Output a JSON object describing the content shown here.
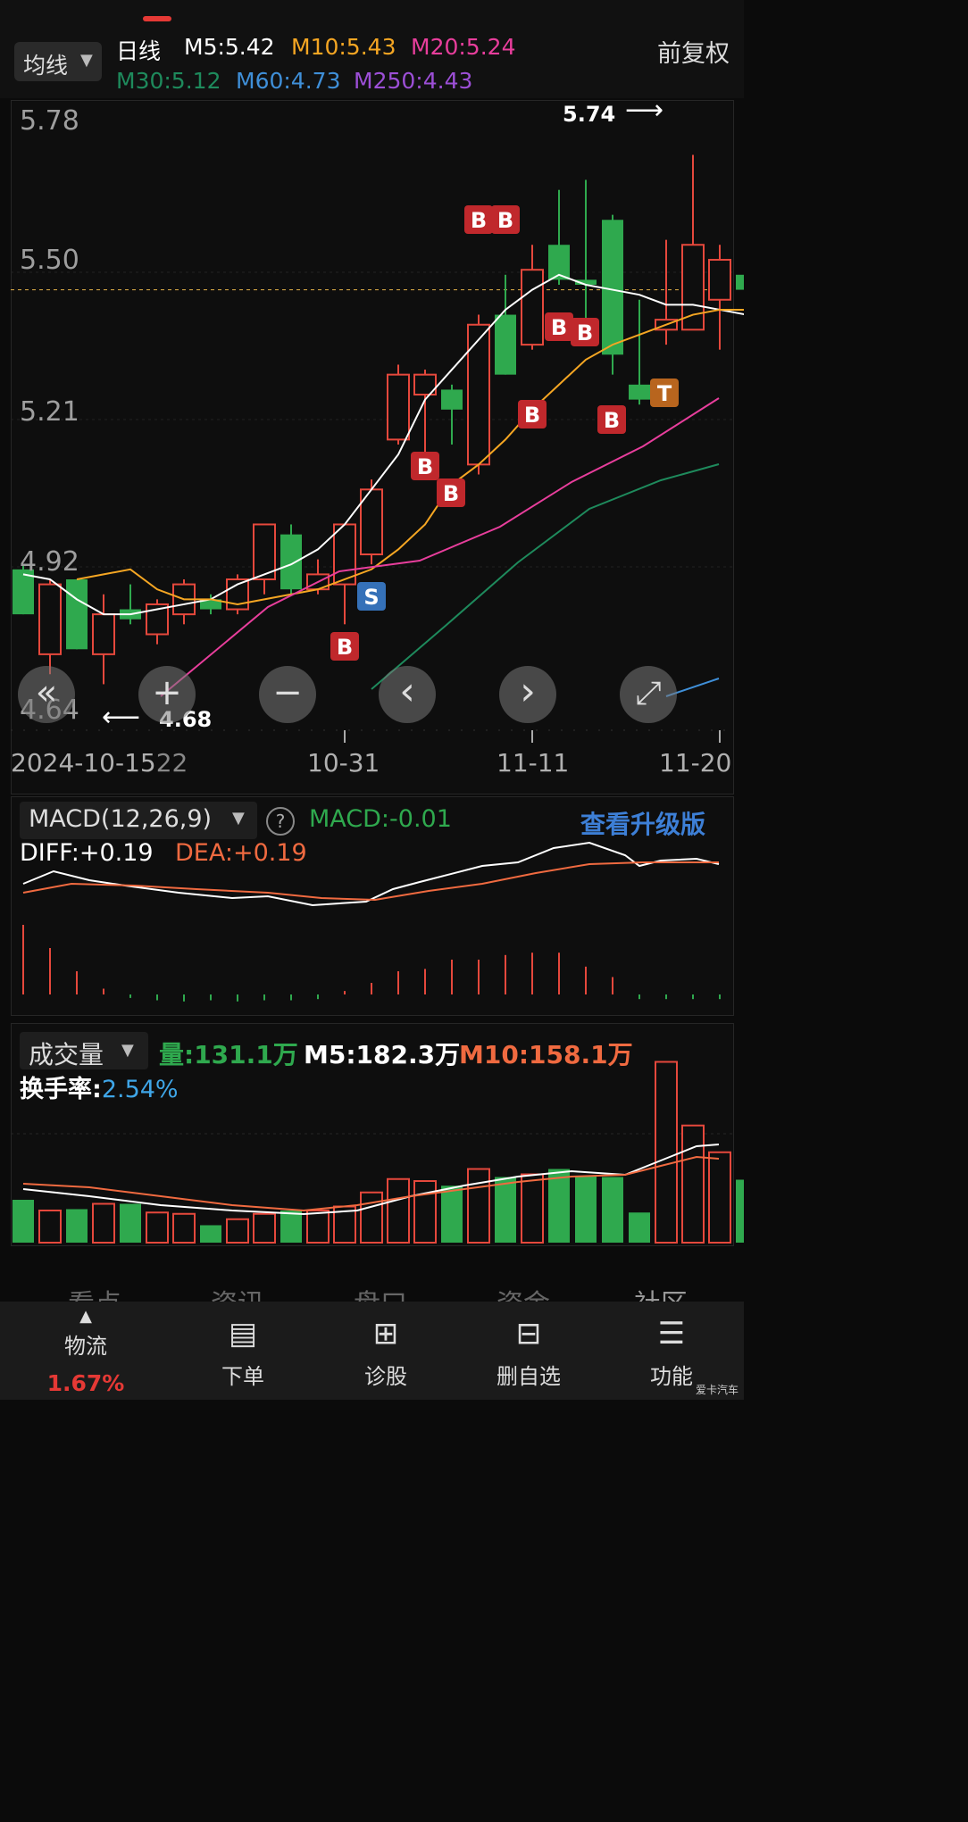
{
  "header": {
    "selector_label": "均线",
    "period_label": "日线",
    "adjust_label": "前复权",
    "ma_labels": [
      {
        "text": "M5:5.42",
        "color": "#ffffff"
      },
      {
        "text": "M10:5.43",
        "color": "#f5a623"
      },
      {
        "text": "M20:5.24",
        "color": "#e83e9c"
      },
      {
        "text": "M30:5.12",
        "color": "#1e8a5c"
      },
      {
        "text": "M60:4.73",
        "color": "#3f8fd8"
      },
      {
        "text": "M250:4.43",
        "color": "#9c4fd6"
      }
    ]
  },
  "main_chart": {
    "y_ticks": [
      "5.78",
      "5.50",
      "5.21",
      "4.92",
      "4.64"
    ],
    "x_ticks": [
      "2024-10-15",
      "22",
      "10-31",
      "11-11",
      "11-20"
    ],
    "high_marker": "5.74",
    "low_marker": "4.68",
    "controls": [
      "«",
      "+",
      "−",
      "‹",
      "›",
      "⤢"
    ]
  },
  "chart_data": [
    {
      "type": "candlestick",
      "y_range": [
        4.62,
        5.8
      ],
      "x": [
        "2024-10-14",
        "2024-10-15",
        "2024-10-16",
        "2024-10-17",
        "2024-10-18",
        "2024-10-21",
        "2024-10-22",
        "2024-10-23",
        "2024-10-24",
        "2024-10-25",
        "2024-10-28",
        "2024-10-29",
        "2024-10-30",
        "2024-10-31",
        "2024-11-01",
        "2024-11-04",
        "2024-11-05",
        "2024-11-06",
        "2024-11-07",
        "2024-11-08",
        "2024-11-11",
        "2024-11-12",
        "2024-11-13",
        "2024-11-14",
        "2024-11-15",
        "2024-11-18",
        "2024-11-19",
        "2024-11-20",
        "2024-11-21",
        "2024-11-22"
      ],
      "candles": [
        {
          "o": 4.91,
          "h": 4.92,
          "l": 4.82,
          "c": 4.82,
          "up": false
        },
        {
          "o": 4.74,
          "h": 4.89,
          "l": 4.7,
          "c": 4.88,
          "up": true
        },
        {
          "o": 4.89,
          "h": 4.89,
          "l": 4.75,
          "c": 4.75,
          "up": false
        },
        {
          "o": 4.74,
          "h": 4.86,
          "l": 4.68,
          "c": 4.82,
          "up": true
        },
        {
          "o": 4.83,
          "h": 4.88,
          "l": 4.8,
          "c": 4.81,
          "up": false
        },
        {
          "o": 4.78,
          "h": 4.85,
          "l": 4.76,
          "c": 4.84,
          "up": true
        },
        {
          "o": 4.82,
          "h": 4.89,
          "l": 4.8,
          "c": 4.88,
          "up": true
        },
        {
          "o": 4.85,
          "h": 4.86,
          "l": 4.82,
          "c": 4.83,
          "up": false
        },
        {
          "o": 4.83,
          "h": 4.9,
          "l": 4.82,
          "c": 4.89,
          "up": true
        },
        {
          "o": 4.89,
          "h": 4.96,
          "l": 4.86,
          "c": 5.0,
          "up": true
        },
        {
          "o": 4.98,
          "h": 5.0,
          "l": 4.86,
          "c": 4.87,
          "up": false
        },
        {
          "o": 4.87,
          "h": 4.93,
          "l": 4.86,
          "c": 4.9,
          "up": true
        },
        {
          "o": 4.88,
          "h": 5.0,
          "l": 4.8,
          "c": 5.0,
          "up": true
        },
        {
          "o": 4.94,
          "h": 5.09,
          "l": 4.92,
          "c": 5.07,
          "up": true
        },
        {
          "o": 5.17,
          "h": 5.32,
          "l": 5.16,
          "c": 5.3,
          "up": true
        },
        {
          "o": 5.26,
          "h": 5.31,
          "l": 5.1,
          "c": 5.3,
          "up": true
        },
        {
          "o": 5.23,
          "h": 5.28,
          "l": 5.16,
          "c": 5.27,
          "up": false
        },
        {
          "o": 5.12,
          "h": 5.42,
          "l": 5.1,
          "c": 5.4,
          "up": true
        },
        {
          "o": 5.42,
          "h": 5.5,
          "l": 5.3,
          "c": 5.3,
          "up": false
        },
        {
          "o": 5.36,
          "h": 5.56,
          "l": 5.35,
          "c": 5.51,
          "up": true
        },
        {
          "o": 5.56,
          "h": 5.67,
          "l": 5.48,
          "c": 5.49,
          "up": false
        },
        {
          "o": 5.49,
          "h": 5.69,
          "l": 5.4,
          "c": 5.48,
          "up": false
        },
        {
          "o": 5.61,
          "h": 5.62,
          "l": 5.3,
          "c": 5.34,
          "up": false
        },
        {
          "o": 5.25,
          "h": 5.45,
          "l": 5.24,
          "c": 5.28,
          "up": false
        },
        {
          "o": 5.41,
          "h": 5.57,
          "l": 5.36,
          "c": 5.39,
          "up": true
        },
        {
          "o": 5.39,
          "h": 5.74,
          "l": 5.39,
          "c": 5.56,
          "up": true
        },
        {
          "o": 5.53,
          "h": 5.56,
          "l": 5.35,
          "c": 5.45,
          "up": true
        },
        {
          "o": 5.5,
          "h": 5.52,
          "l": 5.42,
          "c": 5.47,
          "up": false
        }
      ],
      "ma5": [
        4.9,
        4.89,
        4.85,
        4.82,
        4.82,
        4.83,
        4.84,
        4.85,
        4.88,
        4.9,
        4.92,
        4.95,
        5.0,
        5.07,
        5.14,
        5.25,
        5.31,
        5.37,
        5.43,
        5.47,
        5.5,
        5.48,
        5.47,
        5.46,
        5.44,
        5.44,
        5.43,
        5.42
      ],
      "ma10": [
        4.89,
        4.9,
        4.91,
        4.87,
        4.85,
        4.85,
        4.84,
        4.85,
        4.86,
        4.87,
        4.89,
        4.91,
        4.95,
        5.0,
        5.08,
        5.12,
        5.17,
        5.23,
        5.28,
        5.33,
        5.36,
        5.38,
        5.4,
        5.42,
        5.43,
        5.43
      ]
    },
    {
      "type": "bar",
      "name": "MACD",
      "label": "MACD(12,26,9)",
      "macd_value": "MACD:-0.01",
      "diff_label": "DIFF:+0.19",
      "dea_label": "DEA:+0.19",
      "upgrade_label": "查看升级版",
      "values": [
        0.06,
        0.04,
        0.02,
        0.005,
        -0.003,
        -0.005,
        -0.006,
        -0.005,
        -0.006,
        -0.005,
        -0.005,
        -0.004,
        0.003,
        0.01,
        0.02,
        0.022,
        0.03,
        0.03,
        0.034,
        0.036,
        0.036,
        0.024,
        0.015,
        -0.004,
        -0.004,
        -0.004,
        -0.004
      ]
    },
    {
      "type": "bar",
      "name": "成交量",
      "label": "成交量",
      "vol_label": "量:131.1万",
      "m5_label": "M5:182.3万",
      "m10_label": "M10:158.1万",
      "turnover_label": "换手率:",
      "turnover_value": "2.54%",
      "values": [
        64,
        48,
        50,
        58,
        58,
        45,
        43,
        26,
        35,
        43,
        48,
        48,
        54,
        75,
        95,
        92,
        85,
        110,
        98,
        102,
        110,
        100,
        98,
        45,
        270,
        175,
        135,
        94
      ],
      "up": [
        false,
        true,
        false,
        true,
        false,
        true,
        true,
        false,
        true,
        true,
        false,
        true,
        true,
        true,
        true,
        true,
        false,
        true,
        false,
        true,
        false,
        false,
        false,
        false,
        true,
        true,
        true,
        false
      ]
    }
  ],
  "bottom_nav": {
    "ghost_tabs": [
      "看点",
      "资讯",
      "盘口",
      "资金",
      "社区"
    ],
    "items": [
      {
        "label": "物流",
        "sub": "1.67%",
        "icon": "▲"
      },
      {
        "label": "下单",
        "icon": "▤"
      },
      {
        "label": "诊股",
        "icon": "⊞"
      },
      {
        "label": "删自选",
        "icon": "⊟"
      },
      {
        "label": "功能",
        "icon": "☰"
      }
    ]
  },
  "watermark": "爱卡汽车"
}
